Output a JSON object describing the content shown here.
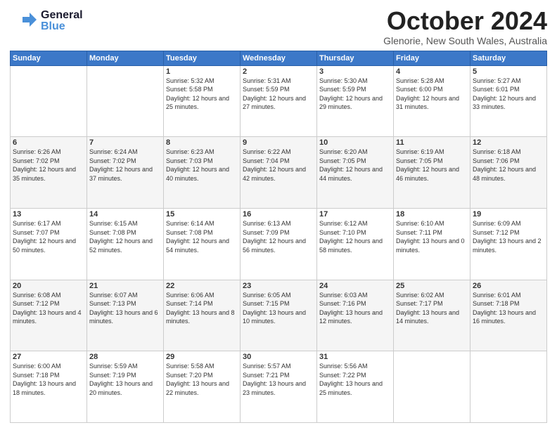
{
  "header": {
    "logo_general": "General",
    "logo_blue": "Blue",
    "title": "October 2024",
    "subtitle": "Glenorie, New South Wales, Australia"
  },
  "days_of_week": [
    "Sunday",
    "Monday",
    "Tuesday",
    "Wednesday",
    "Thursday",
    "Friday",
    "Saturday"
  ],
  "weeks": [
    [
      {
        "day": "",
        "sunrise": "",
        "sunset": "",
        "daylight": ""
      },
      {
        "day": "",
        "sunrise": "",
        "sunset": "",
        "daylight": ""
      },
      {
        "day": "1",
        "sunrise": "Sunrise: 5:32 AM",
        "sunset": "Sunset: 5:58 PM",
        "daylight": "Daylight: 12 hours and 25 minutes."
      },
      {
        "day": "2",
        "sunrise": "Sunrise: 5:31 AM",
        "sunset": "Sunset: 5:59 PM",
        "daylight": "Daylight: 12 hours and 27 minutes."
      },
      {
        "day": "3",
        "sunrise": "Sunrise: 5:30 AM",
        "sunset": "Sunset: 5:59 PM",
        "daylight": "Daylight: 12 hours and 29 minutes."
      },
      {
        "day": "4",
        "sunrise": "Sunrise: 5:28 AM",
        "sunset": "Sunset: 6:00 PM",
        "daylight": "Daylight: 12 hours and 31 minutes."
      },
      {
        "day": "5",
        "sunrise": "Sunrise: 5:27 AM",
        "sunset": "Sunset: 6:01 PM",
        "daylight": "Daylight: 12 hours and 33 minutes."
      }
    ],
    [
      {
        "day": "6",
        "sunrise": "Sunrise: 6:26 AM",
        "sunset": "Sunset: 7:02 PM",
        "daylight": "Daylight: 12 hours and 35 minutes."
      },
      {
        "day": "7",
        "sunrise": "Sunrise: 6:24 AM",
        "sunset": "Sunset: 7:02 PM",
        "daylight": "Daylight: 12 hours and 37 minutes."
      },
      {
        "day": "8",
        "sunrise": "Sunrise: 6:23 AM",
        "sunset": "Sunset: 7:03 PM",
        "daylight": "Daylight: 12 hours and 40 minutes."
      },
      {
        "day": "9",
        "sunrise": "Sunrise: 6:22 AM",
        "sunset": "Sunset: 7:04 PM",
        "daylight": "Daylight: 12 hours and 42 minutes."
      },
      {
        "day": "10",
        "sunrise": "Sunrise: 6:20 AM",
        "sunset": "Sunset: 7:05 PM",
        "daylight": "Daylight: 12 hours and 44 minutes."
      },
      {
        "day": "11",
        "sunrise": "Sunrise: 6:19 AM",
        "sunset": "Sunset: 7:05 PM",
        "daylight": "Daylight: 12 hours and 46 minutes."
      },
      {
        "day": "12",
        "sunrise": "Sunrise: 6:18 AM",
        "sunset": "Sunset: 7:06 PM",
        "daylight": "Daylight: 12 hours and 48 minutes."
      }
    ],
    [
      {
        "day": "13",
        "sunrise": "Sunrise: 6:17 AM",
        "sunset": "Sunset: 7:07 PM",
        "daylight": "Daylight: 12 hours and 50 minutes."
      },
      {
        "day": "14",
        "sunrise": "Sunrise: 6:15 AM",
        "sunset": "Sunset: 7:08 PM",
        "daylight": "Daylight: 12 hours and 52 minutes."
      },
      {
        "day": "15",
        "sunrise": "Sunrise: 6:14 AM",
        "sunset": "Sunset: 7:08 PM",
        "daylight": "Daylight: 12 hours and 54 minutes."
      },
      {
        "day": "16",
        "sunrise": "Sunrise: 6:13 AM",
        "sunset": "Sunset: 7:09 PM",
        "daylight": "Daylight: 12 hours and 56 minutes."
      },
      {
        "day": "17",
        "sunrise": "Sunrise: 6:12 AM",
        "sunset": "Sunset: 7:10 PM",
        "daylight": "Daylight: 12 hours and 58 minutes."
      },
      {
        "day": "18",
        "sunrise": "Sunrise: 6:10 AM",
        "sunset": "Sunset: 7:11 PM",
        "daylight": "Daylight: 13 hours and 0 minutes."
      },
      {
        "day": "19",
        "sunrise": "Sunrise: 6:09 AM",
        "sunset": "Sunset: 7:12 PM",
        "daylight": "Daylight: 13 hours and 2 minutes."
      }
    ],
    [
      {
        "day": "20",
        "sunrise": "Sunrise: 6:08 AM",
        "sunset": "Sunset: 7:12 PM",
        "daylight": "Daylight: 13 hours and 4 minutes."
      },
      {
        "day": "21",
        "sunrise": "Sunrise: 6:07 AM",
        "sunset": "Sunset: 7:13 PM",
        "daylight": "Daylight: 13 hours and 6 minutes."
      },
      {
        "day": "22",
        "sunrise": "Sunrise: 6:06 AM",
        "sunset": "Sunset: 7:14 PM",
        "daylight": "Daylight: 13 hours and 8 minutes."
      },
      {
        "day": "23",
        "sunrise": "Sunrise: 6:05 AM",
        "sunset": "Sunset: 7:15 PM",
        "daylight": "Daylight: 13 hours and 10 minutes."
      },
      {
        "day": "24",
        "sunrise": "Sunrise: 6:03 AM",
        "sunset": "Sunset: 7:16 PM",
        "daylight": "Daylight: 13 hours and 12 minutes."
      },
      {
        "day": "25",
        "sunrise": "Sunrise: 6:02 AM",
        "sunset": "Sunset: 7:17 PM",
        "daylight": "Daylight: 13 hours and 14 minutes."
      },
      {
        "day": "26",
        "sunrise": "Sunrise: 6:01 AM",
        "sunset": "Sunset: 7:18 PM",
        "daylight": "Daylight: 13 hours and 16 minutes."
      }
    ],
    [
      {
        "day": "27",
        "sunrise": "Sunrise: 6:00 AM",
        "sunset": "Sunset: 7:18 PM",
        "daylight": "Daylight: 13 hours and 18 minutes."
      },
      {
        "day": "28",
        "sunrise": "Sunrise: 5:59 AM",
        "sunset": "Sunset: 7:19 PM",
        "daylight": "Daylight: 13 hours and 20 minutes."
      },
      {
        "day": "29",
        "sunrise": "Sunrise: 5:58 AM",
        "sunset": "Sunset: 7:20 PM",
        "daylight": "Daylight: 13 hours and 22 minutes."
      },
      {
        "day": "30",
        "sunrise": "Sunrise: 5:57 AM",
        "sunset": "Sunset: 7:21 PM",
        "daylight": "Daylight: 13 hours and 23 minutes."
      },
      {
        "day": "31",
        "sunrise": "Sunrise: 5:56 AM",
        "sunset": "Sunset: 7:22 PM",
        "daylight": "Daylight: 13 hours and 25 minutes."
      },
      {
        "day": "",
        "sunrise": "",
        "sunset": "",
        "daylight": ""
      },
      {
        "day": "",
        "sunrise": "",
        "sunset": "",
        "daylight": ""
      }
    ]
  ]
}
